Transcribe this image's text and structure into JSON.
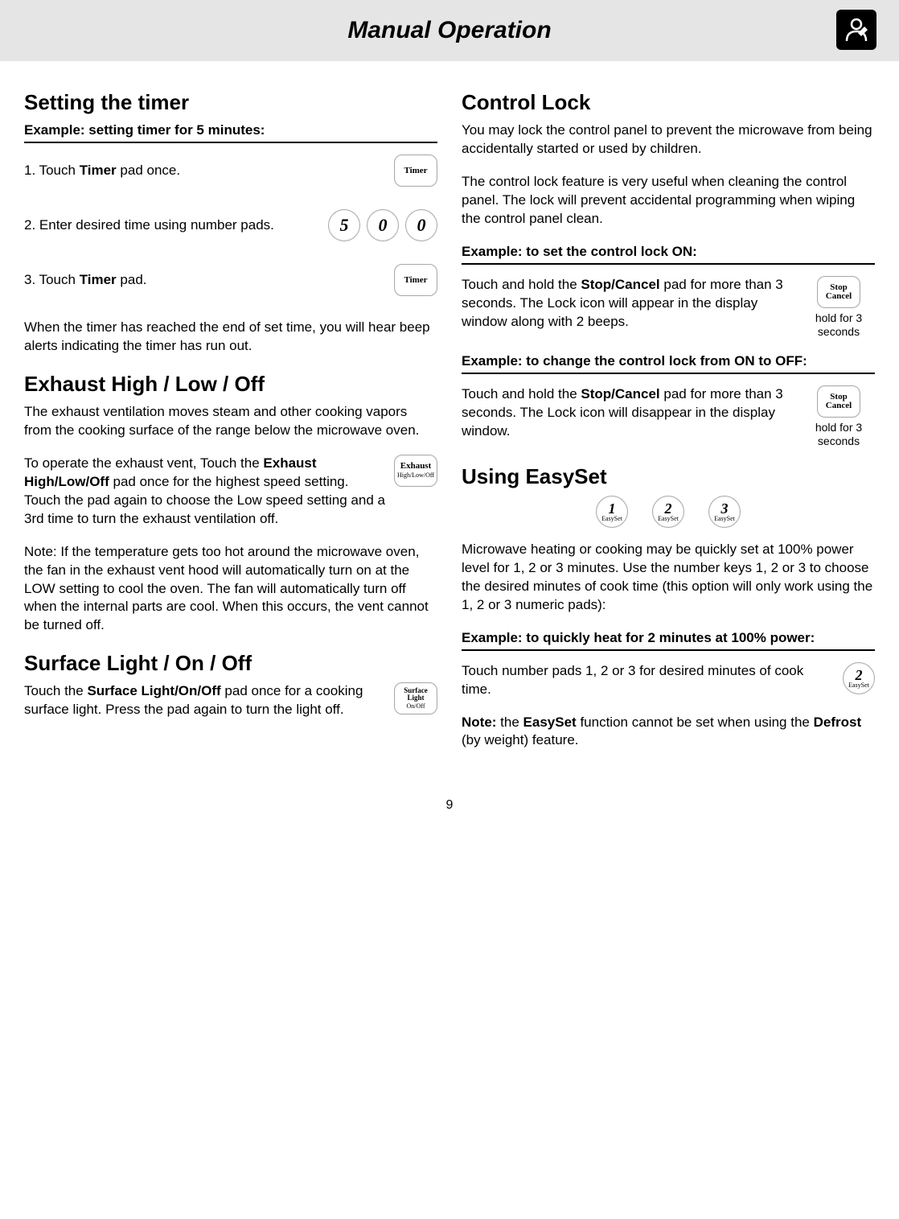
{
  "page_title": "Manual Operation",
  "page_number": "9",
  "left": {
    "timer": {
      "heading": "Setting the timer",
      "example_label": "Example: setting timer for 5 minutes:",
      "step1_prefix": "1.  Touch ",
      "step1_bold": "Timer",
      "step1_suffix": " pad once.",
      "step2": "2.  Enter desired time using number pads.",
      "step3_prefix": "3.  Touch ",
      "step3_bold": "Timer",
      "step3_suffix": " pad.",
      "end_note": "When the timer has reached the end of set time, you will hear beep alerts indicating the timer has run out.",
      "digits": [
        "5",
        "0",
        "0"
      ],
      "timer_pad_label": "Timer"
    },
    "exhaust": {
      "heading": "Exhaust High / Low / Off",
      "intro": "The exhaust ventilation moves steam and other cooking vapors from the cooking surface of the range below the microwave oven.",
      "op_prefix": "To operate the exhaust vent, Touch the ",
      "op_bold": "Exhaust High/Low/Off",
      "op_suffix": " pad once for the highest speed setting. Touch the pad again to choose the Low speed setting and a 3rd time to turn the exhaust ventilation off.",
      "note": "Note: If the temperature gets too hot around the microwave oven, the fan in the exhaust vent hood will automatically turn on at the LOW setting to cool the oven. The fan will automatically turn off when the internal parts are cool. When this occurs, the vent cannot be turned off.",
      "pad_main": "Exhaust",
      "pad_sub": "High/Low/Off"
    },
    "surface": {
      "heading": "Surface Light / On / Off",
      "text_prefix": "Touch the ",
      "text_bold": "Surface Light/On/Off",
      "text_suffix": " pad once for a cooking surface light. Press the pad again to turn the light off.",
      "pad_main": "Surface Light",
      "pad_sub": "On/Off"
    }
  },
  "right": {
    "lock": {
      "heading": "Control Lock",
      "p1": "You may lock the control panel to prevent the microwave from being accidentally started or used by children.",
      "p2": "The control lock feature is very useful when cleaning the control panel. The lock will prevent accidental programming when wiping the control panel clean.",
      "example_on": "Example: to set the control lock ON:",
      "on_prefix": "Touch and hold the ",
      "on_bold": "Stop/Cancel",
      "on_suffix": " pad for more than 3 seconds. The Lock icon will appear in the display window along with 2 beeps.",
      "example_off": "Example: to change the control lock from ON to OFF:",
      "off_prefix": "Touch and hold the ",
      "off_bold": "Stop/Cancel",
      "off_suffix": " pad for more than 3 seconds. The Lock icon will disappear in the display window.",
      "hold_label": "hold for 3 seconds",
      "stop_pad_l1": "Stop",
      "stop_pad_l2": "Cancel"
    },
    "easyset": {
      "heading": "Using EasySet",
      "pads": [
        {
          "num": "1",
          "sub": "EasySet"
        },
        {
          "num": "2",
          "sub": "EasySet"
        },
        {
          "num": "3",
          "sub": "EasySet"
        }
      ],
      "p1": "Microwave heating or cooking may be quickly set at 100% power level for 1, 2 or 3 minutes. Use the number keys  1, 2 or 3 to choose the desired minutes of cook time (this option will only work using the 1, 2 or 3 numeric pads):",
      "example": "Example: to quickly heat for 2 minutes at 100% power:",
      "step": "Touch number pads 1, 2 or 3 for desired minutes of cook time.",
      "step_pad": {
        "num": "2",
        "sub": "EasySet"
      },
      "note_prefix": "Note:",
      "note_mid1": " the ",
      "note_bold1": "EasySet",
      "note_mid2": " function cannot be set when using the ",
      "note_bold2": "Defrost",
      "note_suffix": " (by weight) feature."
    }
  }
}
